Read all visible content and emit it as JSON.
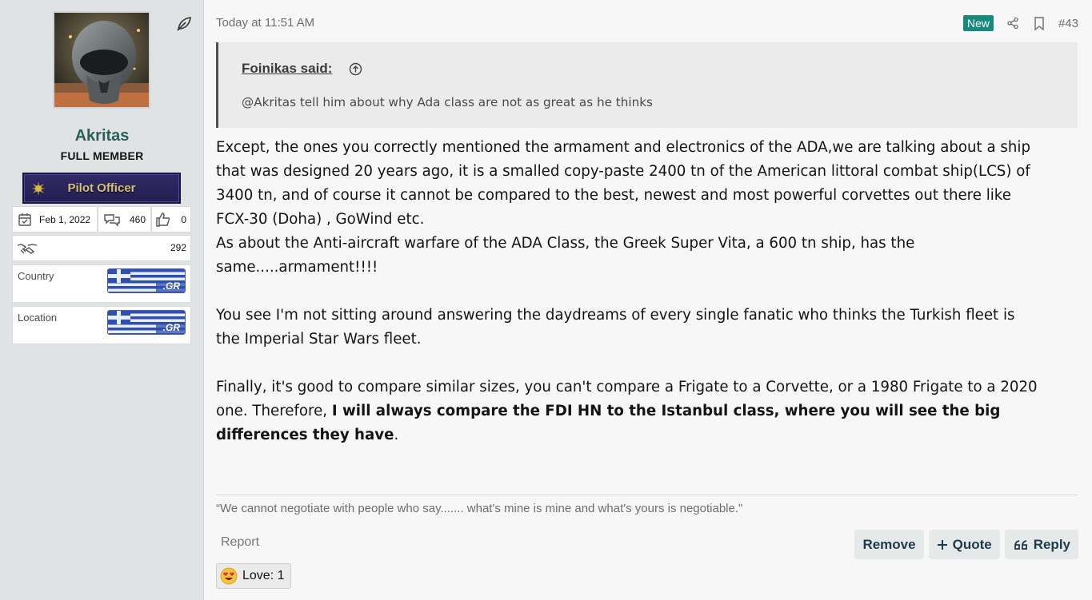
{
  "user": {
    "name": "Akritas",
    "title": "FULL MEMBER",
    "rank": "Pilot Officer",
    "joined": "Feb 1, 2022",
    "messages": "460",
    "reaction_score": "0",
    "points": "292",
    "country_label": "Country",
    "location_label": "Location",
    "flag_text": ".GR"
  },
  "post": {
    "timestamp": "Today at 11:51 AM",
    "new_badge": "New",
    "number": "#43",
    "quote": {
      "author": "Foinikas said:",
      "text": "@Akritas tell him about why Ada class are not as great as he thinks"
    },
    "body": {
      "l1": "Except, the ones you correctly mentioned the armament and electronics of the ADA,we are talking about a ship",
      "l2": "that was designed 20 years ago, it is a smalled copy-paste 2400 tn of the American littoral combat ship(LCS) of",
      "l3": "3400 tn, and of course it cannot be compared to the best, newest and most powerful corvettes out there like",
      "l4": "FCX-30 (Doha) , GoWind etc.",
      "l5": "As about the Anti-aircraft warfare of the ADA Class, the Greek Super Vita, a 600 tn ship, has the",
      "l6": "same.....armament!!!!",
      "l7": "You see I'm not sitting around answering the daydreams of every single fanatic who thinks the Turkish fleet is",
      "l8": "the Imperial Star Wars fleet.",
      "l9": "Finally, it's good to compare similar sizes, you can't compare a Frigate to a Corvette, or a 1980 Frigate to a 2020",
      "l10_a": "one. Therefore, ",
      "l10_b": "I will always compare the FDI HN to the Istanbul class, where you will see the big",
      "l11_a": "differences they have",
      "l11_b": "."
    },
    "signature": "“We cannot negotiate with people who say....... what's mine is mine and what's yours is negotiable.\"",
    "report": "Report",
    "actions": {
      "remove": "Remove",
      "quote": "Quote",
      "reply": "Reply"
    },
    "reaction": "Love: 1"
  },
  "colors": {
    "accent": "#17897d",
    "username": "#2c5e5b",
    "sidebar_bg": "#dfe3e3"
  },
  "icons": [
    "leaf-icon",
    "calendar-icon",
    "messages-icon",
    "thumbs-up-icon",
    "handshake-icon",
    "share-icon",
    "bookmark-icon",
    "jump-up-icon",
    "plus-icon",
    "quote-icon",
    "love-emoji-icon"
  ]
}
